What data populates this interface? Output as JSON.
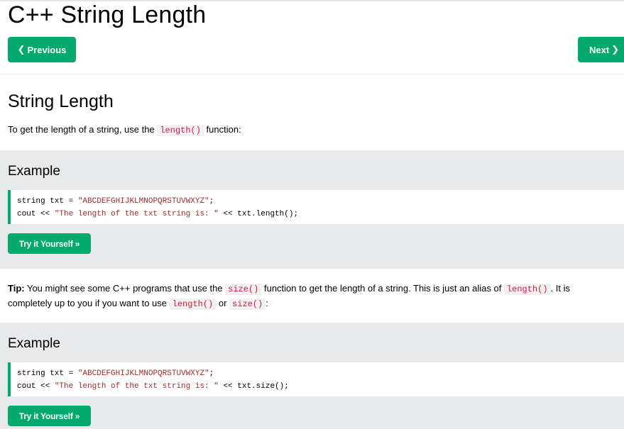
{
  "page": {
    "title": "C++ String Length",
    "prev_label": "Previous",
    "next_label": "Next"
  },
  "section": {
    "heading": "String Length",
    "intro_before": "To get the length of a string, use the ",
    "intro_code": "length()",
    "intro_after": " function:"
  },
  "example1": {
    "title": "Example",
    "line1_a": "string txt = ",
    "line1_str": "\"ABCDEFGHIJKLMNOPQRSTUVWXYZ\"",
    "line1_b": ";",
    "line2_a": "cout << ",
    "line2_str": "\"The length of the txt string is: \"",
    "line2_b": " << txt.length();",
    "try_label": "Try it Yourself »"
  },
  "tip": {
    "label": "Tip:",
    "text1": " You might see some C++ programs that use the ",
    "code1": "size()",
    "text2": " function to get the length of a string. This is just an alias of ",
    "code2": "length()",
    "text3": ". It is completely up to you if you want to use ",
    "code3": "length()",
    "text4": " or ",
    "code4": "size()",
    "text5": ":"
  },
  "example2": {
    "title": "Example",
    "line1_a": "string txt = ",
    "line1_str": "\"ABCDEFGHIJKLMNOPQRSTUVWXYZ\"",
    "line1_b": ";",
    "line2_a": "cout << ",
    "line2_str": "\"The length of the txt string is: \"",
    "line2_b": " << txt.size();",
    "try_label": "Try it Yourself »"
  },
  "icons": {
    "prev": "chevron-left-icon",
    "next": "chevron-right-icon"
  },
  "colors": {
    "accent": "#04aa6d",
    "example_bg": "#e7e9eb",
    "code_string": "#a52a2a",
    "inline_code": "#dc143c"
  }
}
